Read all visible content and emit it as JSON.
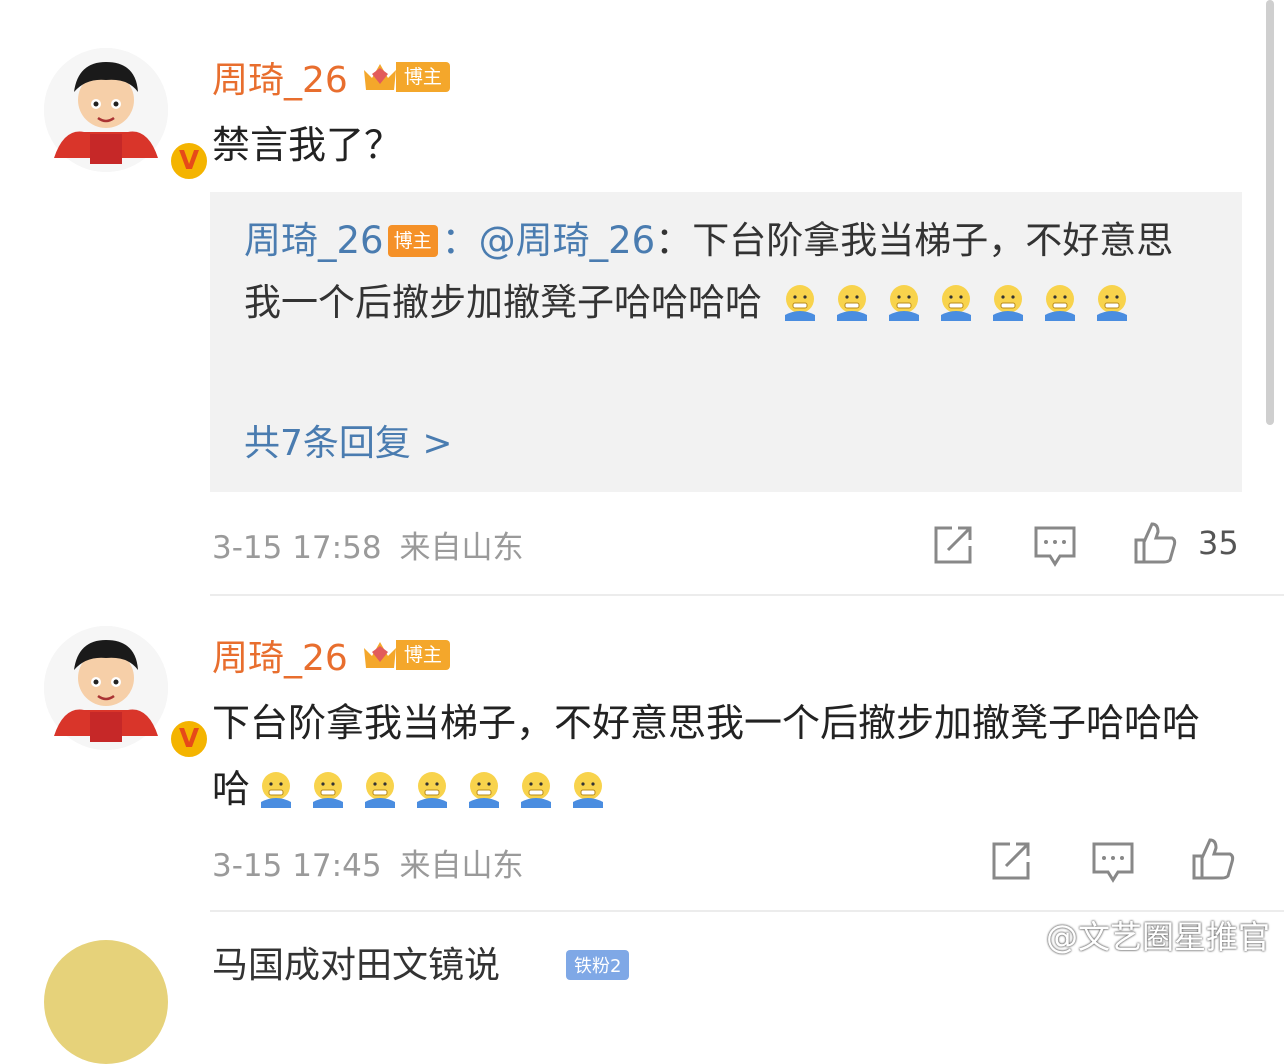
{
  "comment1": {
    "username": "周琦_26",
    "badge": "博主",
    "text": "禁言我了？",
    "quote": {
      "username": "周琦_26",
      "tag": "博主",
      "separator": "：",
      "mention": "@周琦_26",
      "text_before": "：下台阶拿我当梯子，不好意思我一个后撤步加撤凳子哈哈哈哈",
      "more": "共7条回复 >"
    },
    "time": "3-15 17:58",
    "location": "来自山东",
    "likes": "35"
  },
  "comment2": {
    "username": "周琦_26",
    "badge": "博主",
    "text": "下台阶拿我当梯子，不好意思我一个后撤步加撤凳子哈哈哈哈",
    "time": "3-15 17:45",
    "location": "来自山东"
  },
  "comment3": {
    "username": "马国成对田文镜说",
    "badge": "铁粉2"
  },
  "watermark": "@文艺圈星推官",
  "colors": {
    "username": "#e86e2e",
    "link": "#4a7cb0",
    "quote_bg": "#f2f2f2",
    "badge": "#f4a72b"
  }
}
